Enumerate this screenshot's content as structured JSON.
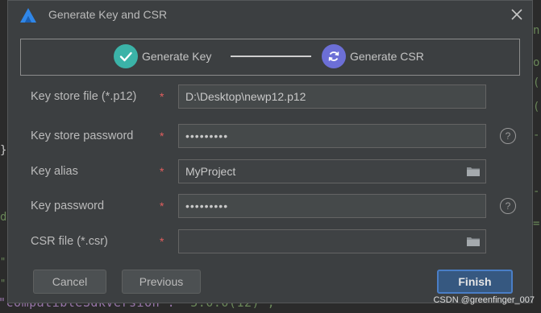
{
  "dialog": {
    "title": "Generate Key and CSR",
    "close_glyph": "×"
  },
  "steps": [
    {
      "label": "Generate Key",
      "state": "done",
      "icon": "check-icon"
    },
    {
      "label": "Generate CSR",
      "state": "active",
      "icon": "refresh-icon"
    }
  ],
  "form": {
    "keystore_file": {
      "label": "Key store file (*.p12)",
      "required": "*",
      "value": "D:\\Desktop\\newp12.p12"
    },
    "keystore_password": {
      "label": "Key store password",
      "required": "*",
      "value": "•••••••••",
      "help": "?"
    },
    "key_alias": {
      "label": "Key alias",
      "required": "*",
      "value": "MyProject"
    },
    "key_password": {
      "label": "Key password",
      "required": "*",
      "value": "•••••••••",
      "help": "?"
    },
    "csr_file": {
      "label": "CSR file (*.csr)",
      "required": "*",
      "value": ""
    }
  },
  "buttons": {
    "cancel": "Cancel",
    "previous": "Previous",
    "finish": "Finish"
  },
  "background": {
    "brace": "}",
    "d_char": "d",
    "dot1": "\"",
    "dot2": "\"",
    "bottom_key": "\"compatibleSdkVersion\": ",
    "bottom_value": "\"5.0.0(12)\",",
    "right_chars": [
      "n",
      "o",
      "(",
      "(",
      "-",
      "-",
      "="
    ]
  },
  "watermark": "CSDN @greenfinger_007",
  "colors": {
    "dialog_bg": "#3c3f41",
    "step_done": "#3bb3a8",
    "step_active": "#6c6fd6",
    "required": "#e05d5d",
    "finish_bg": "#365880"
  }
}
